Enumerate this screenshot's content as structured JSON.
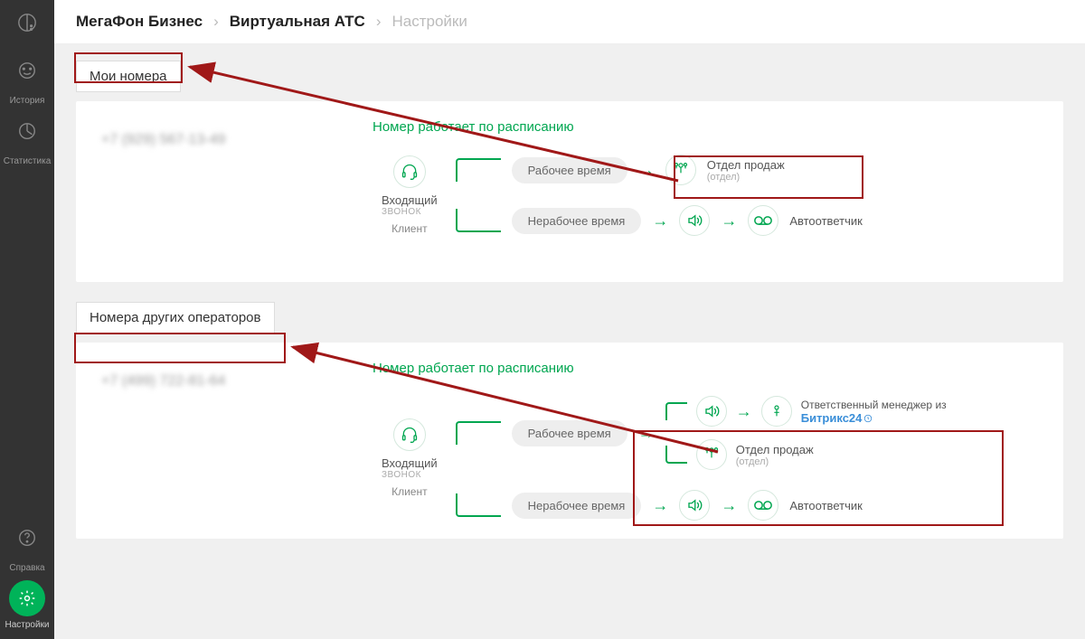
{
  "sidebar": {
    "items": [
      {
        "label": "История"
      },
      {
        "label": "Статистика"
      },
      {
        "label": "Справка"
      },
      {
        "label": "Настройки"
      }
    ]
  },
  "breadcrumb": {
    "root": "МегаФон Бизнес",
    "mid": "Виртуальная АТС",
    "leaf": "Настройки"
  },
  "sections": {
    "my_numbers_title": "Мои номера",
    "other_operators_title": "Номера других операторов"
  },
  "card1": {
    "phone": "+7 (929) 567-13-49",
    "schedule_title": "Номер работает по расписанию",
    "client_label": "Клиент",
    "incoming_label": "Входящий",
    "incoming_sub": "звонок",
    "work_time": "Рабочее время",
    "nonwork_time": "Нерабочее время",
    "sales_dept": "Отдел продаж",
    "dept_sub": "(отдел)",
    "answering": "Автоответчик"
  },
  "card2": {
    "phone": "+7 (499) 722-81-64",
    "schedule_title": "Номер работает по расписанию",
    "client_label": "Клиент",
    "incoming_label": "Входящий",
    "incoming_sub": "звонок",
    "work_time": "Рабочее время",
    "nonwork_time": "Нерабочее время",
    "sales_dept": "Отдел продаж",
    "dept_sub": "(отдел)",
    "responsible": "Ответственный менеджер из",
    "bitrix": "Битрикс24",
    "answering": "Автоответчик"
  }
}
